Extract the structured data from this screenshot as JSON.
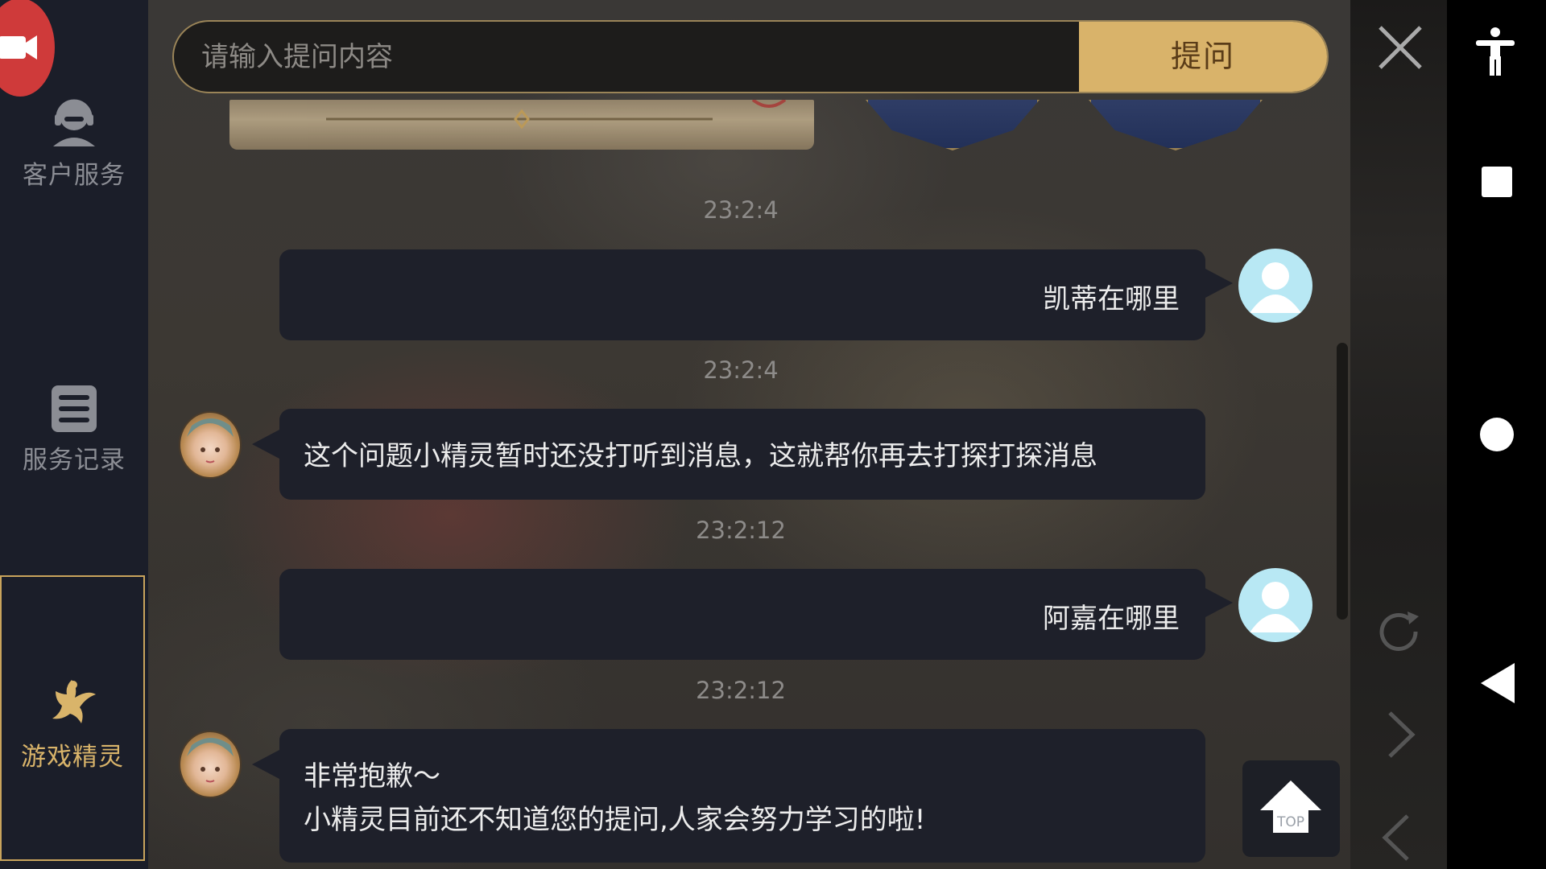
{
  "sidebar": {
    "items": [
      {
        "label": "客户服务",
        "icon": "customer-service-icon"
      },
      {
        "label": "服务记录",
        "icon": "records-list-icon"
      },
      {
        "label": "游戏精灵",
        "icon": "fairy-icon",
        "selected": true
      }
    ]
  },
  "search": {
    "placeholder": "请输入提问内容",
    "value": "",
    "submit_label": "提问"
  },
  "chat": {
    "messages": [
      {
        "time": "23:2:4",
        "sender": "user",
        "text": "凯蒂在哪里"
      },
      {
        "time": "23:2:4",
        "sender": "sprite",
        "text": "这个问题小精灵暂时还没打听到消息，这就帮你再去打探打探消息"
      },
      {
        "time": "23:2:12",
        "sender": "user",
        "text": "阿嘉在哪里"
      },
      {
        "time": "23:2:12",
        "sender": "sprite",
        "text_lines": [
          "非常抱歉～",
          "小精灵目前还不知道您的提问,人家会努力学习的啦!"
        ]
      }
    ]
  },
  "top_button": {
    "label": "TOP"
  },
  "colors": {
    "accent_gold": "#d9b36a",
    "sidebar_bg": "#1b1e29",
    "bubble_bg": "#1e202a",
    "user_avatar": "#b8e8f4",
    "record_red": "#cf3a3a"
  }
}
